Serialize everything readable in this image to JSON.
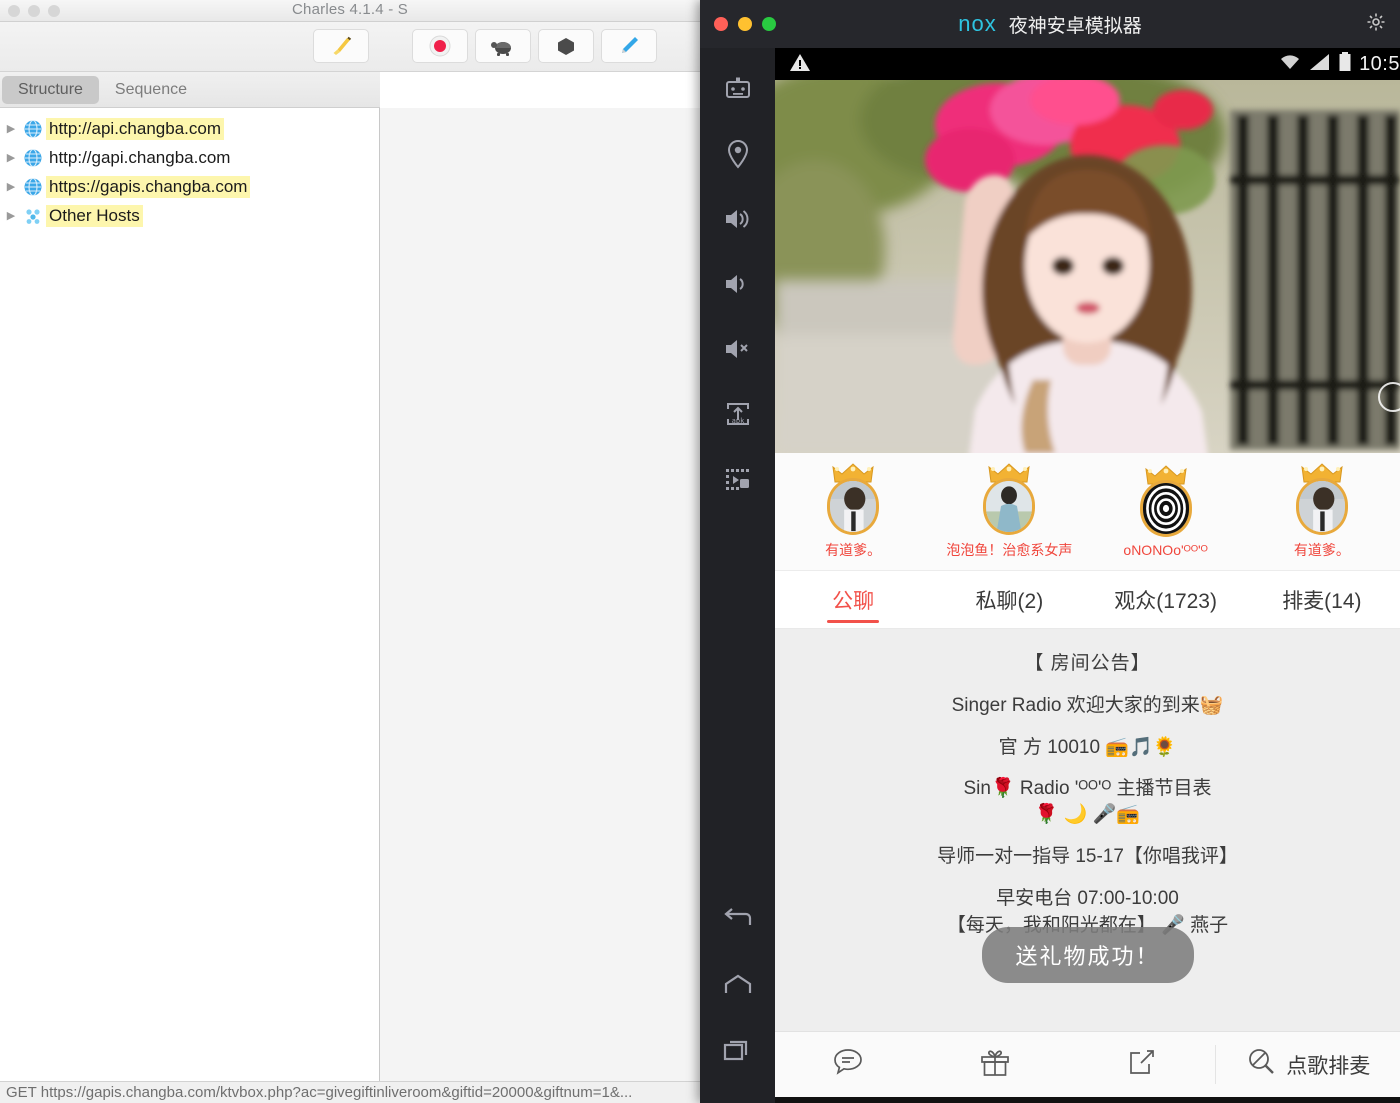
{
  "charles": {
    "window_title": "Charles 4.1.4 - S",
    "traffic_lights": [
      "close",
      "minimize",
      "zoom"
    ],
    "toolbar": {
      "buttons": [
        {
          "name": "clear-session",
          "icon": "broom-icon"
        },
        {
          "name": "record-toggle",
          "icon": "record-icon"
        },
        {
          "name": "throttle-settings",
          "icon": "turtle-icon"
        },
        {
          "name": "breakpoint-settings",
          "icon": "hexagon-icon"
        },
        {
          "name": "compose-request",
          "icon": "pen-icon"
        }
      ]
    },
    "tabs": [
      {
        "label": "Structure",
        "active": true
      },
      {
        "label": "Sequence",
        "active": false
      }
    ],
    "tree": [
      {
        "label": "http://api.changba.com",
        "highlighted": true,
        "icon": "globe-icon"
      },
      {
        "label": "http://gapi.changba.com",
        "highlighted": false,
        "icon": "globe-icon"
      },
      {
        "label": "https://gapis.changba.com",
        "highlighted": true,
        "icon": "globe-icon"
      },
      {
        "label": "Other Hosts",
        "highlighted": true,
        "icon": "hosts-cluster-icon"
      }
    ],
    "status_bar": "GET https://gapis.changba.com/ktvbox.php?ac=givegiftinliveroom&giftid=20000&giftnum=1&..."
  },
  "nox": {
    "logo_text": "nox",
    "app_name": "夜神安卓模拟器",
    "settings_icon": "gear-icon",
    "traffic_lights": [
      {
        "name": "close",
        "color": "#ff6058"
      },
      {
        "name": "minimize",
        "color": "#ffc130"
      },
      {
        "name": "maximize",
        "color": "#29ca41"
      }
    ],
    "rail_top": [
      {
        "name": "toolbox",
        "icon": "robot-icon"
      },
      {
        "name": "location",
        "icon": "location-pin-icon"
      },
      {
        "name": "volume-up",
        "icon": "volume-up-icon"
      },
      {
        "name": "volume-down",
        "icon": "volume-down-icon"
      },
      {
        "name": "volume-mute",
        "icon": "volume-mute-icon"
      },
      {
        "name": "install-apk",
        "icon": "apk-install-icon"
      },
      {
        "name": "screen-record",
        "icon": "screen-record-icon"
      }
    ],
    "rail_bottom": [
      {
        "name": "back",
        "icon": "back-arrow-icon"
      },
      {
        "name": "home",
        "icon": "home-icon"
      },
      {
        "name": "recents",
        "icon": "recents-icon"
      }
    ]
  },
  "android": {
    "status_bar": {
      "warning_icon": "warning-triangle-icon",
      "wifi_icon": "wifi-icon",
      "signal_icon": "signal-bars-icon",
      "battery_icon": "battery-full-icon",
      "clock": "10:5"
    }
  },
  "app": {
    "avatars": [
      {
        "name": "有道爹。",
        "image": "person-photo",
        "crown": true
      },
      {
        "name": "泡泡鱼！治愈系女声",
        "image": "person-photo",
        "crown": true
      },
      {
        "name": "oNONOo'ᴼᴼ'ᴼ",
        "image": "spiral-pattern",
        "crown": true
      },
      {
        "name": "有道爹。",
        "image": "person-photo",
        "crown": true
      }
    ],
    "tabs": [
      {
        "label": "公聊",
        "active": true
      },
      {
        "label": "私聊(2)",
        "active": false
      },
      {
        "label": "观众(1723)",
        "active": false
      },
      {
        "label": "排麦(14)",
        "active": false
      }
    ],
    "announcement": [
      "【 房间公告】",
      "Singer Radio 欢迎大家的到来🧺",
      "官 方 10010  📻🎵🌻",
      "Sin🌹 Radio 'ᴼᴼ'ᴼ 主播节目表",
      "🌹 🌙  🎤📻",
      "导师一对一指导   15-17【你唱我评】",
      "早安电台  07:00-10:00",
      "【每天，我和阳光都在】  🎤 燕子"
    ],
    "toast": "送礼物成功！",
    "action_bar": [
      {
        "name": "chat",
        "icon": "chat-bubble-icon",
        "label": ""
      },
      {
        "name": "gift",
        "icon": "gift-icon",
        "label": ""
      },
      {
        "name": "share",
        "icon": "share-icon",
        "label": ""
      },
      {
        "name": "song-request",
        "icon": "song-search-icon",
        "label": "点歌排麦"
      }
    ]
  },
  "colors": {
    "accent_red": "#f2514a",
    "avatar_name_red": "#f0463c",
    "highlight_yellow": "#fdf6ad",
    "nox_cyan": "#2ec3e0"
  }
}
